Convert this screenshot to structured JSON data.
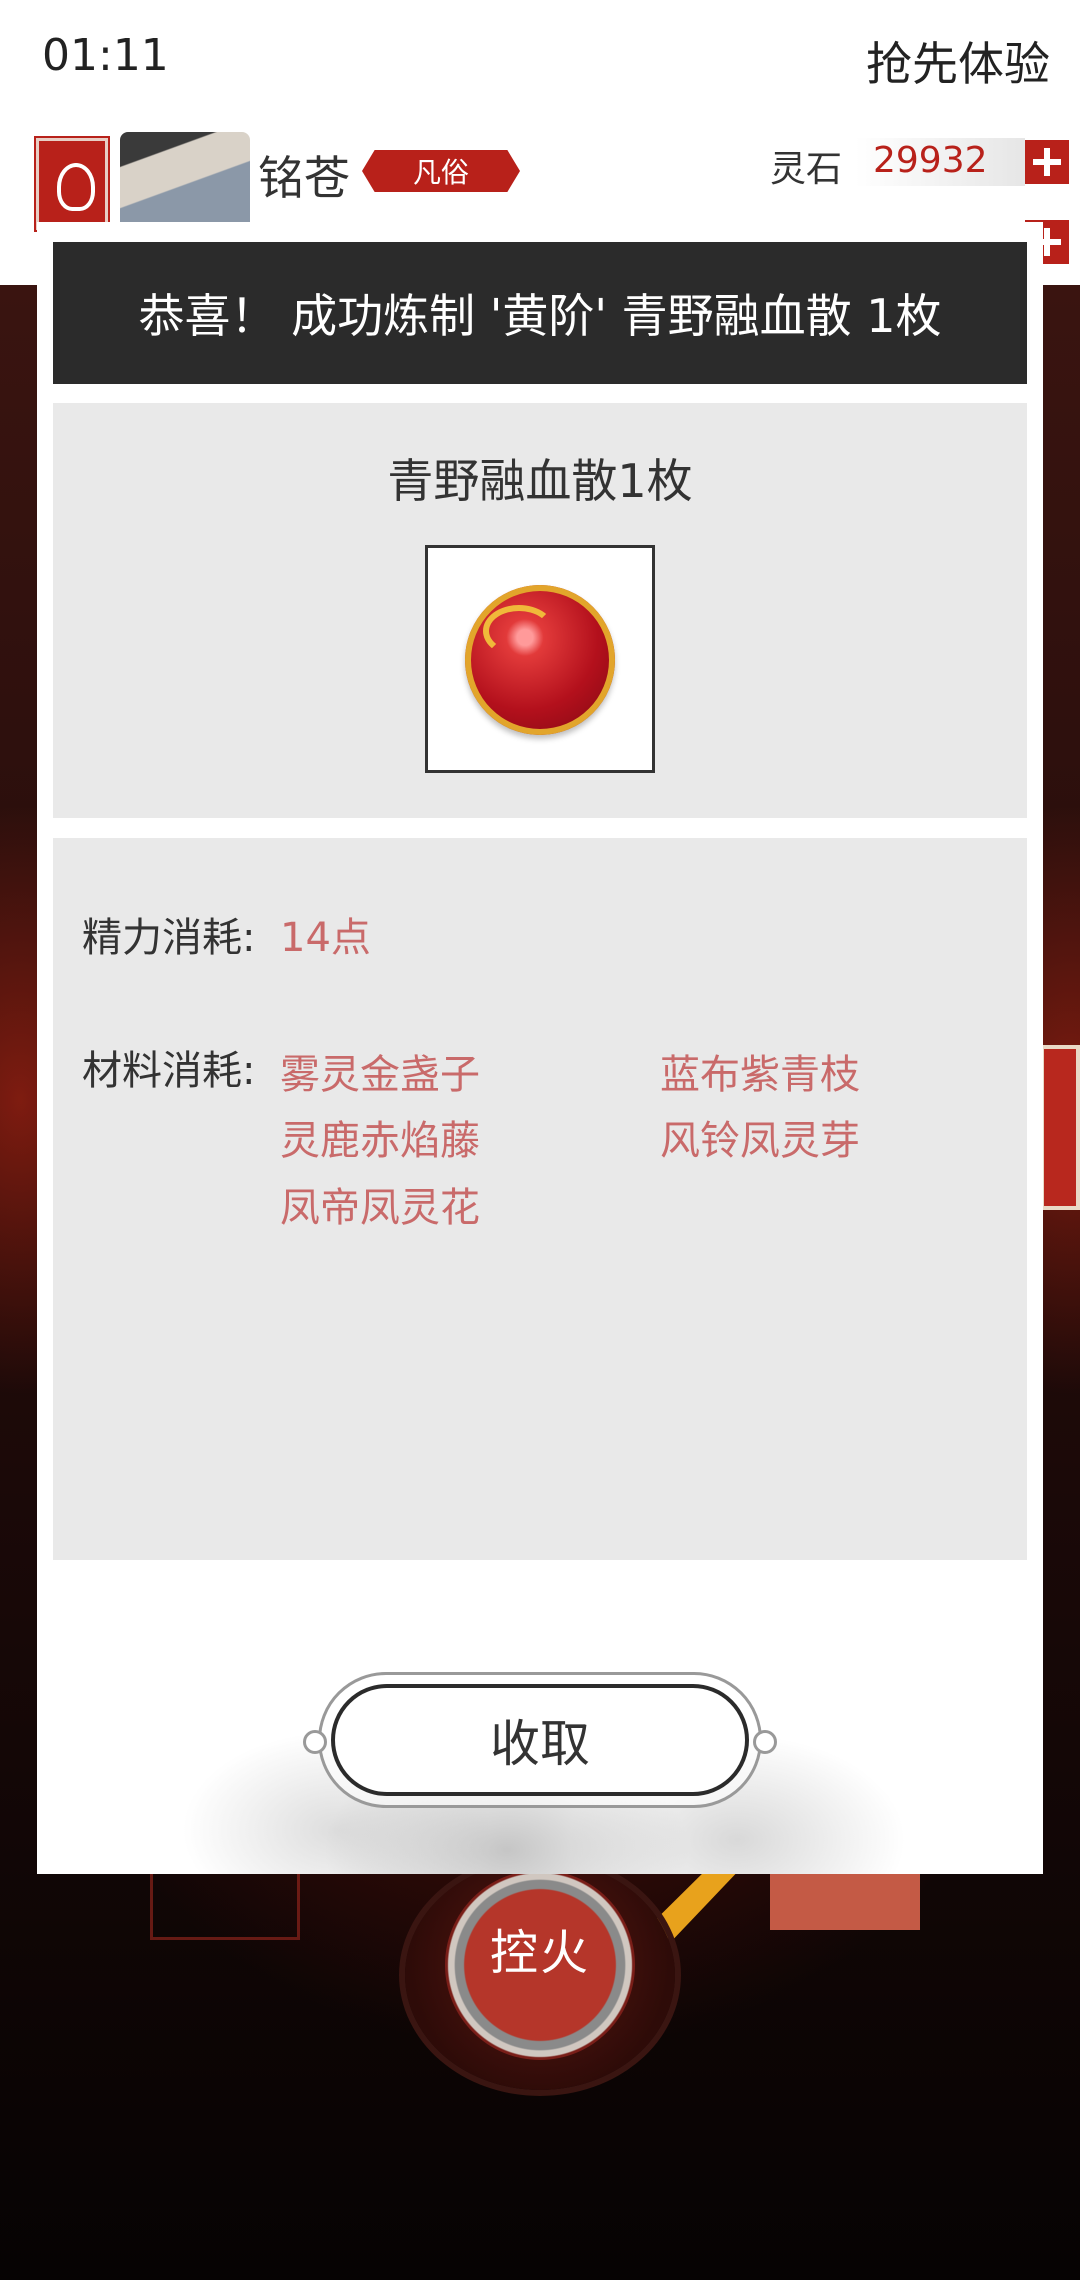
{
  "status_bar": {
    "time": "01:11",
    "right_text": "抢先体验"
  },
  "header": {
    "player_name": "铭苍",
    "rank": "凡俗",
    "spirit_stone_label": "灵石",
    "spirit_stone_value": "29932"
  },
  "modal": {
    "banner": "恭喜！ 成功炼制 '黄阶' 青野融血散 1枚",
    "product_name": "青野融血散1枚",
    "product_icon": "elixir-orb",
    "energy_label": "精力消耗:",
    "energy_value": "14点",
    "material_label": "材料消耗:",
    "materials": [
      "雾灵金盏子",
      "蓝布紫青枝",
      "灵鹿赤焰藤",
      "风铃凤灵芽",
      "凤帝凤灵花"
    ],
    "collect_button": "收取"
  },
  "background": {
    "fire_button": "控火"
  },
  "colors": {
    "accent_red": "#b8211a",
    "material_text": "#c96a6a",
    "banner_bg": "#2b2b2b",
    "panel_bg": "#e9e9e9"
  }
}
